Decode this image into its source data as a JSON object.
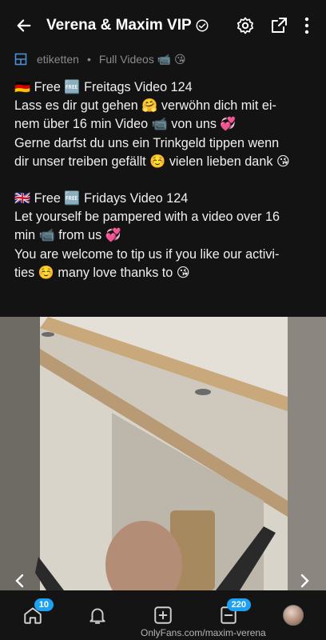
{
  "header": {
    "title": "Verena & Maxim VIP",
    "verified_icon": "verified-badge-icon",
    "icons": [
      "back-arrow-icon",
      "gear-icon",
      "share-icon",
      "more-vertical-icon"
    ]
  },
  "tags": {
    "tag_label": "etiketten",
    "separator": "•",
    "category": "Full Videos 📹 😘"
  },
  "post": {
    "de_line1": "🇩🇪 Free 🆓 Freitags Video 124",
    "de_line2": "Lass es dir gut gehen 🤗 verwöhn dich mit ei-",
    "de_line3": "nem über 16 min Video 📹 von uns 💞",
    "de_line4": "Gerne darfst du uns ein Trinkgeld tippen wenn",
    "de_line5": "dir unser treiben gefällt ☺️ vielen lieben dank 😘",
    "en_line1": "🇬🇧 Free 🆓 Fridays Video 124",
    "en_line2": "Let yourself be pampered with a video over 16",
    "en_line3": "min 📹 from us 💞",
    "en_line4": "You are welcome to tip us if you like our activi-",
    "en_line5": "ties ☺️ many love thanks to 😘"
  },
  "nav": {
    "home_badge": "10",
    "messages_badge": "220",
    "watermark": "OnlyFans.com/maxim-verena"
  },
  "colors": {
    "background": "#131313",
    "text": "#f0f0f0",
    "muted": "#8a8a8a",
    "accent": "#1da1f2"
  }
}
